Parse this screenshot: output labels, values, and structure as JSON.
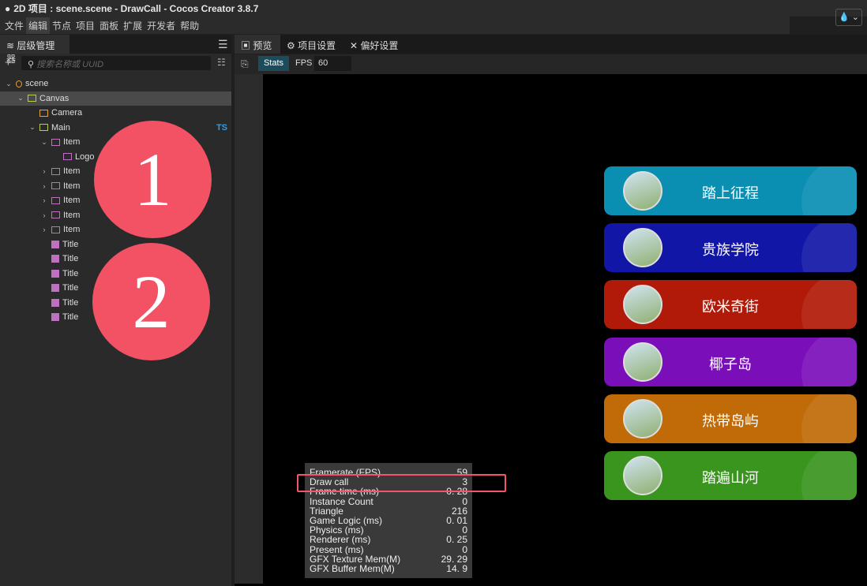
{
  "window": {
    "title": "2D 项目 : scene.scene - DrawCall - Cocos Creator 3.8.7",
    "theme_icon": "water-drop-icon"
  },
  "menu": [
    "文件",
    "编辑",
    "节点",
    "项目",
    "面板",
    "扩展",
    "开发者",
    "帮助"
  ],
  "hierarchy": {
    "tab": "层级管理器",
    "search_placeholder": "搜索名称或 UUID",
    "nodes": [
      {
        "label": "scene",
        "depth": 0,
        "arrow": "v",
        "icon": "scene"
      },
      {
        "label": "Canvas",
        "depth": 1,
        "arrow": "v",
        "icon": "canvas",
        "selected": true
      },
      {
        "label": "Camera",
        "depth": 2,
        "arrow": "",
        "icon": "camera"
      },
      {
        "label": "Main",
        "depth": 2,
        "arrow": "v",
        "icon": "canvas",
        "badge": "TS"
      },
      {
        "label": "Item",
        "depth": 3,
        "arrow": "v",
        "icon": "sprite"
      },
      {
        "label": "Logo",
        "depth": 4,
        "arrow": "",
        "icon": "sprite"
      },
      {
        "label": "Item",
        "depth": 3,
        "arrow": ">",
        "icon": "sprite"
      },
      {
        "label": "Item",
        "depth": 3,
        "arrow": ">",
        "icon": "sprite"
      },
      {
        "label": "Item",
        "depth": 3,
        "arrow": ">",
        "icon": "sprite"
      },
      {
        "label": "Item",
        "depth": 3,
        "arrow": ">",
        "icon": "sprite"
      },
      {
        "label": "Item",
        "depth": 3,
        "arrow": ">",
        "icon": "sprite"
      },
      {
        "label": "Title",
        "depth": 3,
        "arrow": "",
        "icon": "label"
      },
      {
        "label": "Title",
        "depth": 3,
        "arrow": "",
        "icon": "label"
      },
      {
        "label": "Title",
        "depth": 3,
        "arrow": "",
        "icon": "label"
      },
      {
        "label": "Title",
        "depth": 3,
        "arrow": "",
        "icon": "label"
      },
      {
        "label": "Title",
        "depth": 3,
        "arrow": "",
        "icon": "label"
      },
      {
        "label": "Title",
        "depth": 3,
        "arrow": "",
        "icon": "label"
      }
    ]
  },
  "annotations": [
    "1",
    "2"
  ],
  "tabs": [
    "预览",
    "项目设置",
    "偏好设置"
  ],
  "toolbar": {
    "stats": "Stats",
    "fps_label": "FPS",
    "fps_value": "60"
  },
  "cards": [
    {
      "title": "踏上征程",
      "color": "#0a8fb3"
    },
    {
      "title": "贵族学院",
      "color": "#1216a6"
    },
    {
      "title": "欧米奇街",
      "color": "#b11a08"
    },
    {
      "title": "椰子岛",
      "color": "#7a0fba"
    },
    {
      "title": "热带岛屿",
      "color": "#c06b08"
    },
    {
      "title": "踏遍山河",
      "color": "#3a951f"
    }
  ],
  "stats": [
    [
      "Framerate (FPS)",
      "59"
    ],
    [
      "Draw call",
      "3"
    ],
    [
      "Frame time (ms)",
      "0. 28"
    ],
    [
      "Instance Count",
      "0"
    ],
    [
      "Triangle",
      "216"
    ],
    [
      "Game Logic (ms)",
      "0. 01"
    ],
    [
      "Physics (ms)",
      "0"
    ],
    [
      "Renderer (ms)",
      "0. 25"
    ],
    [
      "Present (ms)",
      "0"
    ],
    [
      "GFX Texture Mem(M)",
      "29. 29"
    ],
    [
      "GFX Buffer Mem(M)",
      "14. 9"
    ]
  ]
}
